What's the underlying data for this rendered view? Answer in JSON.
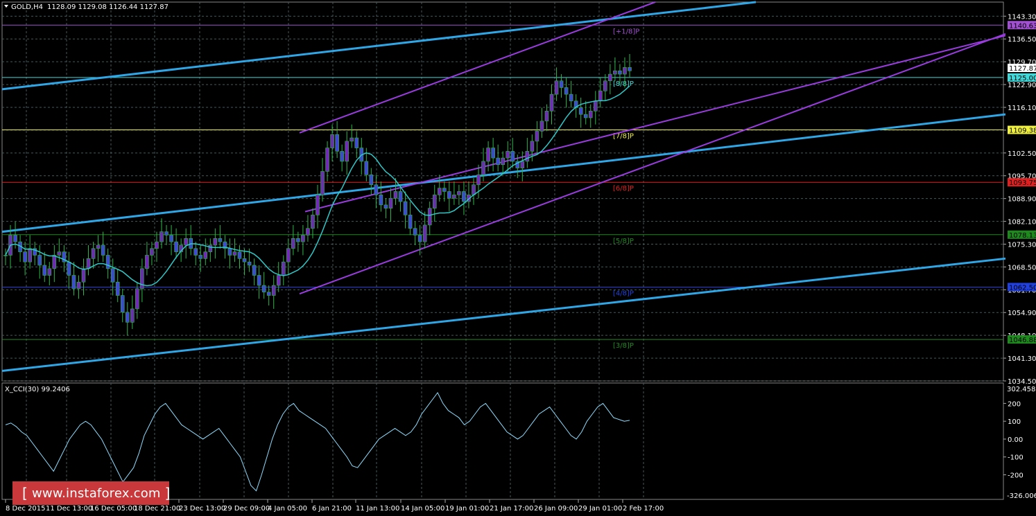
{
  "header": {
    "symbol": "GOLD,H4",
    "ohlc": "1128.09 1129.08 1126.44 1127.87"
  },
  "indicator": {
    "label": "X_CCI(30) 99.2406",
    "axis_top": "302.4585",
    "axis_bottom": "-326.0061",
    "ticks": [
      "200",
      "100",
      "0.00",
      "-100",
      "-200"
    ]
  },
  "watermark": {
    "open": "[",
    "text": "www.instaforex.com",
    "close": "]"
  },
  "colors": {
    "background": "#000000",
    "bull": "#2db84a",
    "bear": "#2db84a",
    "candle_up": "#6f2bb4",
    "candle_down": "#3f4ad0",
    "ma": "#30c8c8",
    "channel_blue": "#2fa6e6",
    "channel_purple": "#9a3ce0",
    "grid": "#465a5a",
    "cci": "#8fdcff"
  },
  "chart_data": {
    "type": "candlestick",
    "title": "GOLD,H4",
    "ylim": [
      1034.5,
      1148.0
    ],
    "price_axis_ticks": [
      "1143.30",
      "1136.50",
      "1129.70",
      "1122.90",
      "1116.10",
      "1109.30",
      "1102.50",
      "1095.70",
      "1088.90",
      "1082.10",
      "1075.30",
      "1068.50",
      "1061.70",
      "1054.90",
      "1048.10",
      "1041.30",
      "1034.50"
    ],
    "x_axis_labels": [
      "8 Dec 2015",
      "11 Dec 13:00",
      "16 Dec 05:00",
      "18 Dec 21:00",
      "23 Dec 13:00",
      "29 Dec 09:00",
      "4 Jan 05:00",
      "6 Jan 21:00",
      "11 Jan 13:00",
      "14 Jan 05:00",
      "19 Jan 01:00",
      "21 Jan 17:00",
      "26 Jan 09:00",
      "29 Jan 01:00",
      "2 Feb 17:00"
    ],
    "price_badges": [
      {
        "text": "1140.63",
        "value": 1140.63,
        "color": "#a050d0"
      },
      {
        "text": "1127.87",
        "value": 1127.87,
        "color": "#ffffff"
      },
      {
        "text": "1125.00",
        "value": 1125.0,
        "color": "#40d8d8"
      },
      {
        "text": "1109.38",
        "value": 1109.38,
        "color": "#f0f040"
      },
      {
        "text": "1093.75",
        "value": 1093.75,
        "color": "#e02020"
      },
      {
        "text": "1078.13",
        "value": 1078.13,
        "color": "#1e8a1e"
      },
      {
        "text": "1062.50",
        "value": 1062.5,
        "color": "#2040e0"
      },
      {
        "text": "1046.88",
        "value": 1046.88,
        "color": "#1e8a1e"
      }
    ],
    "murrey_levels": [
      {
        "label": "[+1/8]P",
        "value": 1140.63,
        "color": "#a050d0"
      },
      {
        "label": "[8/8]P",
        "value": 1125.0,
        "color": "#40d8d8"
      },
      {
        "label": "[7/8]P",
        "value": 1109.38,
        "color": "#f0f040"
      },
      {
        "label": "[6/8]P",
        "value": 1093.75,
        "color": "#e02020"
      },
      {
        "label": "[5/8]P",
        "value": 1078.13,
        "color": "#1e8a1e"
      },
      {
        "label": "[4/8]P",
        "value": 1062.5,
        "color": "#2040e0"
      },
      {
        "label": "[3/8]P",
        "value": 1046.88,
        "color": "#1e8a1e"
      }
    ],
    "closes": [
      1072,
      1078,
      1076,
      1073,
      1070,
      1074,
      1072,
      1069,
      1066,
      1068,
      1072,
      1073,
      1070,
      1066,
      1062,
      1064,
      1068,
      1071,
      1074,
      1075,
      1072,
      1068,
      1064,
      1060,
      1055,
      1052,
      1056,
      1062,
      1068,
      1072,
      1074,
      1076,
      1079,
      1078,
      1076,
      1073,
      1075,
      1077,
      1074,
      1072,
      1071,
      1073,
      1075,
      1077,
      1076,
      1074,
      1072,
      1073,
      1071,
      1070,
      1069,
      1066,
      1063,
      1061,
      1060,
      1063,
      1066,
      1070,
      1074,
      1077,
      1076,
      1078,
      1080,
      1084,
      1090,
      1097,
      1104,
      1108,
      1103,
      1100,
      1106,
      1107,
      1104,
      1100,
      1096,
      1093,
      1090,
      1087,
      1086,
      1089,
      1091,
      1088,
      1084,
      1080,
      1078,
      1076,
      1081,
      1086,
      1090,
      1092,
      1091,
      1089,
      1090,
      1091,
      1088,
      1090,
      1093,
      1096,
      1100,
      1104,
      1101,
      1099,
      1101,
      1103,
      1100,
      1098,
      1100,
      1103,
      1106,
      1109,
      1112,
      1115,
      1120,
      1124,
      1122,
      1120,
      1118,
      1116,
      1114,
      1113,
      1115,
      1118,
      1121,
      1124,
      1126,
      1127,
      1126,
      1128,
      1127
    ],
    "cci_values": [
      80,
      90,
      70,
      40,
      20,
      -20,
      -60,
      -100,
      -140,
      -180,
      -120,
      -60,
      0,
      40,
      80,
      100,
      80,
      40,
      0,
      -60,
      -120,
      -180,
      -240,
      -200,
      -160,
      -80,
      20,
      80,
      140,
      180,
      200,
      160,
      120,
      80,
      60,
      40,
      20,
      0,
      20,
      40,
      60,
      20,
      -20,
      -60,
      -100,
      -180,
      -260,
      -290,
      -200,
      -100,
      0,
      80,
      140,
      180,
      200,
      160,
      140,
      120,
      100,
      80,
      60,
      20,
      -20,
      -60,
      -100,
      -150,
      -160,
      -120,
      -80,
      -40,
      0,
      20,
      40,
      60,
      40,
      20,
      40,
      80,
      140,
      180,
      220,
      260,
      200,
      160,
      140,
      120,
      80,
      100,
      140,
      180,
      200,
      160,
      120,
      80,
      40,
      20,
      0,
      20,
      60,
      100,
      140,
      160,
      180,
      140,
      100,
      60,
      20,
      0,
      40,
      100,
      140,
      180,
      200,
      160,
      120,
      110,
      100,
      105
    ]
  }
}
